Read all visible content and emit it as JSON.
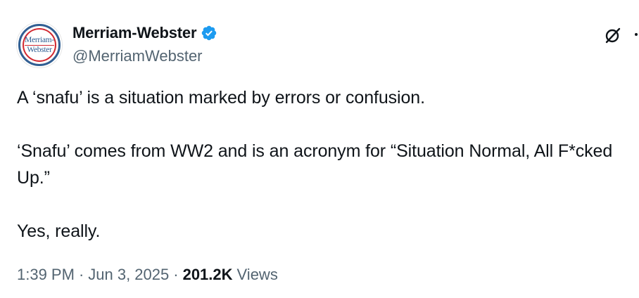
{
  "author": {
    "display_name": "Merriam-Webster",
    "handle": "@MerriamWebster",
    "verified": true,
    "avatar_text_line1": "Merriam-",
    "avatar_text_line2": "Webster"
  },
  "icons": {
    "verified": "verified-badge-icon",
    "grok": "grok-icon",
    "more": "more-options-icon"
  },
  "tweet": {
    "text": "A ‘snafu’ is a situation marked by errors or confusion.\n\n‘Snafu’ comes from WW2 and is an acronym for “Situation Normal, All F*cked Up.”\n\nYes, really."
  },
  "meta": {
    "time": "1:39 PM",
    "separator": "·",
    "date": "Jun 3, 2025",
    "views_count": "201.2K",
    "views_label": "Views"
  },
  "colors": {
    "text_primary": "#0f1419",
    "text_secondary": "#536471",
    "verified_blue": "#1d9bf0",
    "brand_blue": "#305f93",
    "brand_red": "#d22830"
  }
}
